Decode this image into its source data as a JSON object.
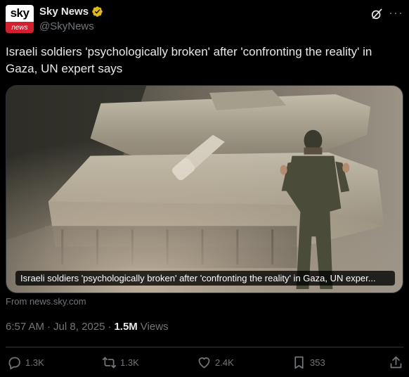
{
  "author": {
    "avatar_top": "sky",
    "avatar_bottom": "news",
    "display_name": "Sky News",
    "handle": "@SkyNews"
  },
  "tweet": {
    "text": "Israeli soldiers 'psychologically broken' after 'confronting the reality' in Gaza, UN expert says"
  },
  "card": {
    "caption": "Israeli soldiers 'psychologically broken' after 'confronting the reality' in Gaza, UN exper...",
    "source": "From news.sky.com"
  },
  "meta": {
    "time": "6:57 AM",
    "separator": "·",
    "date": "Jul 8, 2025",
    "views_count": "1.5M",
    "views_label": "Views"
  },
  "actions": {
    "replies": "1.3K",
    "reposts": "1.3K",
    "likes": "2.4K",
    "bookmarks": "353"
  },
  "colors": {
    "background": "#000000",
    "text": "#e7e9ea",
    "muted": "#71767b",
    "verified_gold": "#e2b719",
    "sky_red": "#d2202f"
  }
}
